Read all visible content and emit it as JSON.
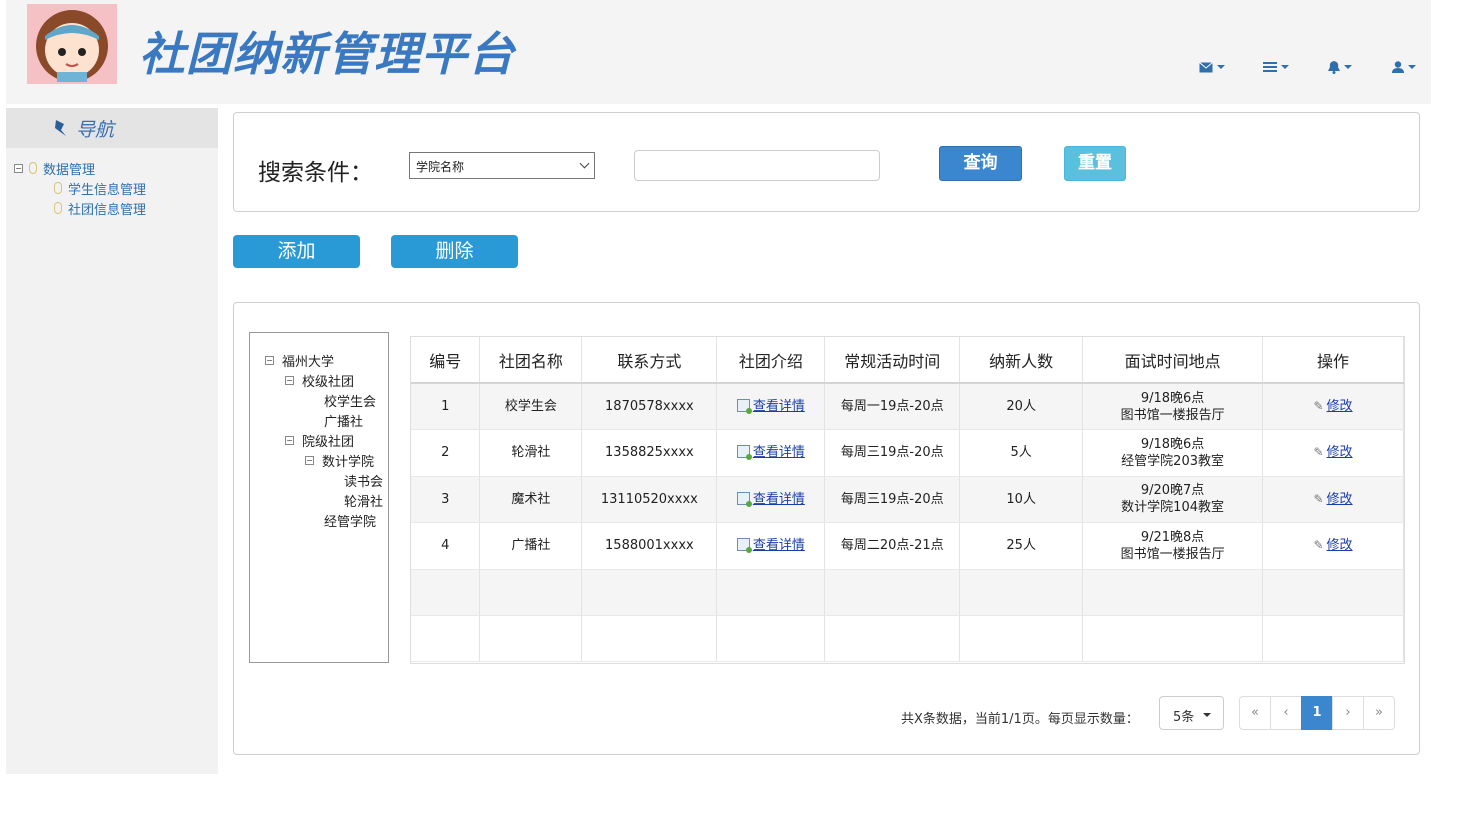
{
  "header": {
    "title": "社团纳新管理平台",
    "icons": [
      "envelope-icon",
      "list-icon",
      "bell-icon",
      "user-icon"
    ]
  },
  "sidebar": {
    "nav_title": "导航",
    "root": "数据管理",
    "items": [
      {
        "label": "学生信息管理"
      },
      {
        "label": "社团信息管理"
      }
    ]
  },
  "search": {
    "label": "搜索条件：",
    "select_value": "学院名称",
    "input_value": "",
    "query_label": "查询",
    "reset_label": "重置"
  },
  "actions": {
    "add_label": "添加",
    "delete_label": "删除"
  },
  "tree": {
    "root": "福州大学",
    "school_level": "校级社团",
    "school_children": [
      "校学生会",
      "广播社"
    ],
    "college_level": "院级社团",
    "college_math": "数计学院",
    "math_children": [
      "读书会",
      "轮滑社"
    ],
    "college_econ": "经管学院"
  },
  "table": {
    "headers": [
      "编号",
      "社团名称",
      "联系方式",
      "社团介绍",
      "常规活动时间",
      "纳新人数",
      "面试时间地点",
      "操作"
    ],
    "detail_link": "查看详情",
    "edit_link": "修改",
    "rows": [
      {
        "id": "1",
        "name": "校学生会",
        "contact": "1870578xxxx",
        "activity": "每周一19点-20点",
        "count": "20人",
        "interview_time": "9/18晚6点",
        "interview_place": "图书馆一楼报告厅"
      },
      {
        "id": "2",
        "name": "轮滑社",
        "contact": "1358825xxxx",
        "activity": "每周三19点-20点",
        "count": "5人",
        "interview_time": "9/18晚6点",
        "interview_place": "经管学院203教室"
      },
      {
        "id": "3",
        "name": "魔术社",
        "contact": "13110520xxxx",
        "activity": "每周三19点-20点",
        "count": "10人",
        "interview_time": "9/20晚7点",
        "interview_place": "数计学院104教室"
      },
      {
        "id": "4",
        "name": "广播社",
        "contact": "1588001xxxx",
        "activity": "每周二20点-21点",
        "count": "25人",
        "interview_time": "9/21晚8点",
        "interview_place": "图书馆一楼报告厅"
      }
    ]
  },
  "pagination": {
    "info": "共X条数据，当前1/1页。每页显示数量：",
    "page_size": "5条",
    "first": "«",
    "prev": "‹",
    "current": "1",
    "next": "›",
    "last": "»"
  },
  "colors": {
    "title": "#3a78c2",
    "primary_button": "#3a87cf",
    "info_button": "#5bc0de",
    "action_button": "#2a9ad6"
  }
}
